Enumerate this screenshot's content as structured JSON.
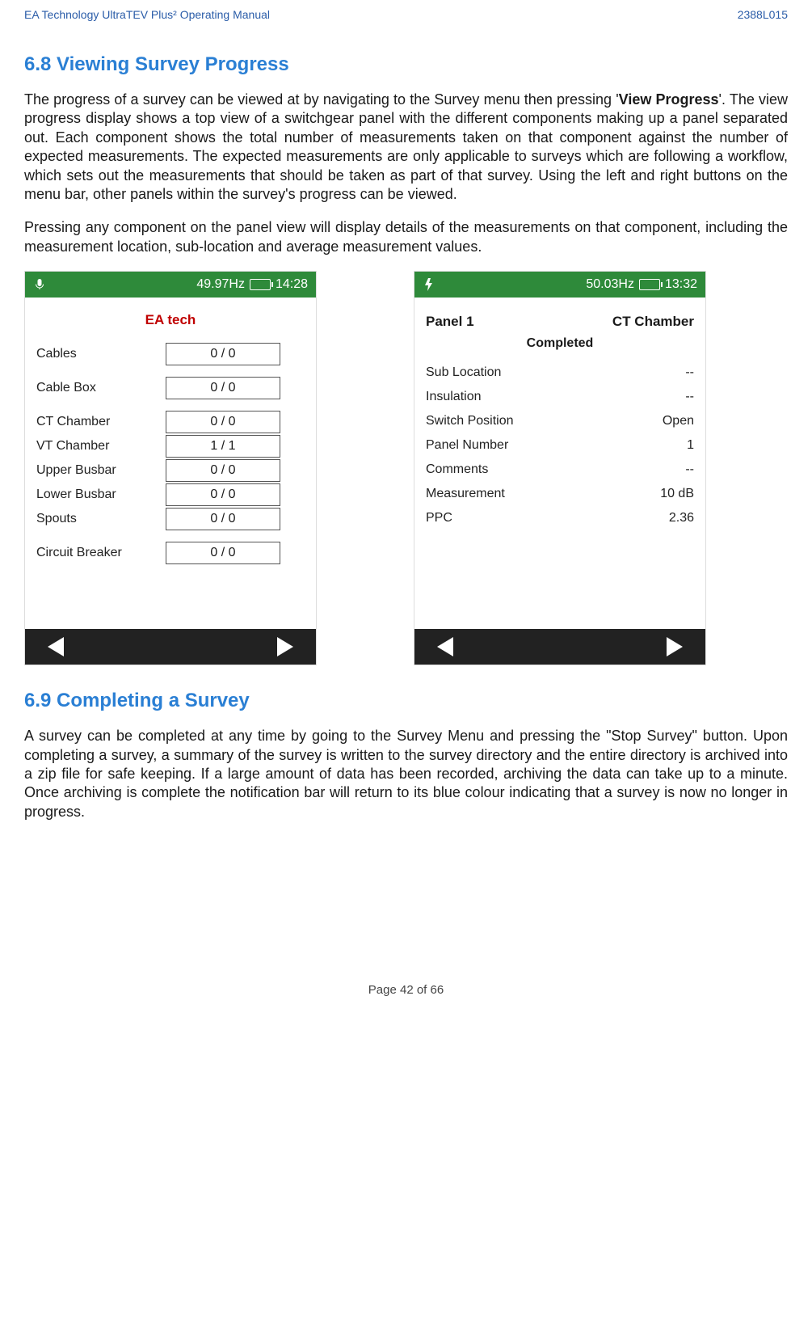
{
  "header": {
    "left": "EA Technology UltraTEV Plus² Operating Manual",
    "right": "2388L015"
  },
  "section68": {
    "heading": "6.8    Viewing Survey Progress",
    "p1a": "The progress of a survey can be viewed at by navigating to the Survey menu then pressing '",
    "p1bold": "View Progress",
    "p1b": "'. The view progress display shows a top view of a switchgear panel with the different components making up a panel separated out. Each component shows the total number of measurements taken on that component against the number of expected measurements. The expected measurements are only applicable to surveys which are following a workflow, which sets out the measurements that should be taken as part of that survey. Using the left and right buttons on the menu bar, other panels within the survey's progress can be viewed.",
    "p2": "Pressing any component on the panel view will display details of the measurements on that component, including the measurement location, sub-location and average measurement values."
  },
  "screen1": {
    "hz": "49.97Hz",
    "time": "14:28",
    "title": "EA tech",
    "rows": [
      {
        "label": "Cables",
        "value": "0 / 0",
        "spaced": true
      },
      {
        "label": "Cable Box",
        "value": "0 / 0",
        "spaced": true
      },
      {
        "label": "CT Chamber",
        "value": "0 / 0",
        "spaced": false
      },
      {
        "label": "VT Chamber",
        "value": "1 / 1",
        "spaced": false
      },
      {
        "label": "Upper Busbar",
        "value": "0 / 0",
        "spaced": false
      },
      {
        "label": "Lower Busbar",
        "value": "0 / 0",
        "spaced": false
      },
      {
        "label": "Spouts",
        "value": "0 / 0",
        "spaced": true
      },
      {
        "label": "Circuit Breaker",
        "value": "0 / 0",
        "spaced": false
      }
    ]
  },
  "screen2": {
    "hz": "50.03Hz",
    "time": "13:32",
    "panel": "Panel 1",
    "component": "CT Chamber",
    "status": "Completed",
    "rows": [
      {
        "label": "Sub Location",
        "value": "--"
      },
      {
        "label": "Insulation",
        "value": "--"
      },
      {
        "label": "Switch Position",
        "value": "Open"
      },
      {
        "label": "Panel Number",
        "value": "1"
      },
      {
        "label": "Comments",
        "value": "--"
      },
      {
        "label": "Measurement",
        "value": "10 dB"
      },
      {
        "label": "PPC",
        "value": "2.36"
      }
    ]
  },
  "section69": {
    "heading": "6.9    Completing a Survey",
    "p1": "A survey can be completed at any time by going to the Survey Menu and pressing the \"Stop Survey\" button. Upon completing a survey, a summary of the survey is written to the survey directory and the entire directory is archived into a zip file for safe keeping. If a large amount of data has been recorded, archiving the data can take up to a minute. Once archiving is complete the notification bar will return to its blue colour indicating that a survey is now no longer in progress."
  },
  "footer": "Page 42 of 66"
}
